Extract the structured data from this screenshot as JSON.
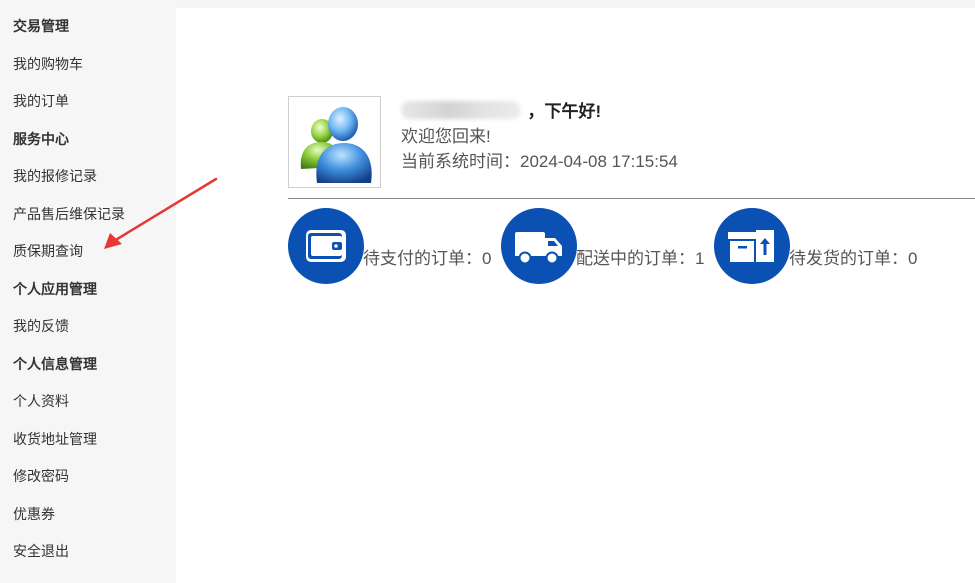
{
  "sidebar": {
    "items": [
      {
        "label": "交易管理",
        "type": "section"
      },
      {
        "label": "我的购物车",
        "type": "link"
      },
      {
        "label": "我的订单",
        "type": "link"
      },
      {
        "label": "服务中心",
        "type": "section"
      },
      {
        "label": "我的报修记录",
        "type": "link"
      },
      {
        "label": "产品售后维保记录",
        "type": "link"
      },
      {
        "label": "质保期查询",
        "type": "link"
      },
      {
        "label": "个人应用管理",
        "type": "section"
      },
      {
        "label": "我的反馈",
        "type": "link"
      },
      {
        "label": "个人信息管理",
        "type": "section"
      },
      {
        "label": "个人资料",
        "type": "link"
      },
      {
        "label": "收货地址管理",
        "type": "link"
      },
      {
        "label": "修改密码",
        "type": "link"
      },
      {
        "label": "优惠券",
        "type": "link"
      },
      {
        "label": "安全退出",
        "type": "link"
      }
    ]
  },
  "profile": {
    "greeting": "，下午好!",
    "welcome": "欢迎您回来!",
    "system_time": "当前系统时间：2024-04-08 17:15:54"
  },
  "stats": [
    {
      "label": "待支付的订单：0",
      "icon": "wallet-icon"
    },
    {
      "label": "配送中的订单：1",
      "icon": "truck-icon"
    },
    {
      "label": "待发货的订单：0",
      "icon": "package-icon"
    }
  ],
  "colors": {
    "accent": "#0a51b3",
    "annotation": "#e53935"
  }
}
